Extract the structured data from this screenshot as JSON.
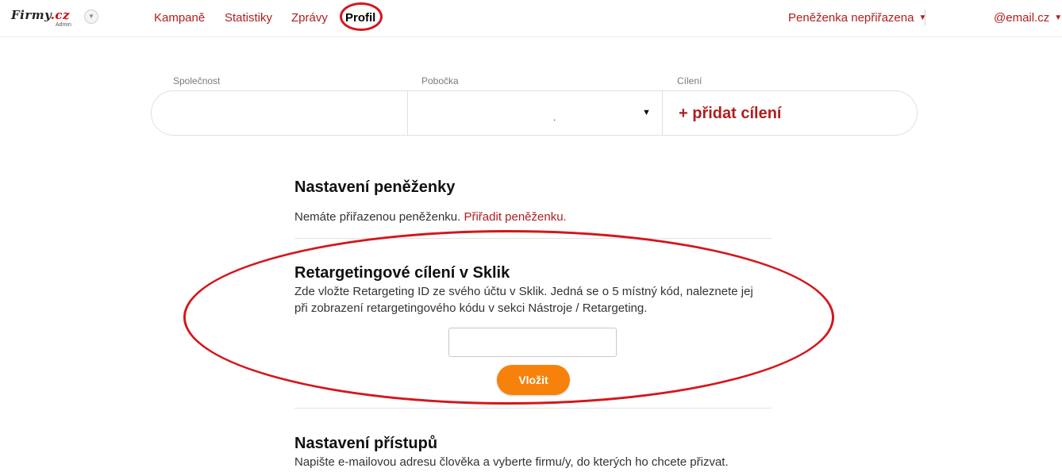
{
  "logo": {
    "brand": "Firmy",
    "domain": ".cz",
    "sub": "Admin"
  },
  "nav": [
    {
      "label": "Kampaně"
    },
    {
      "label": "Statistiky"
    },
    {
      "label": "Zprávy"
    },
    {
      "label": "Profil",
      "active": true
    }
  ],
  "header": {
    "wallet_status": "Peněženka nepřiřazena",
    "account": "@email.cz",
    "caret": "▼"
  },
  "filters": {
    "company_label": "Společnost",
    "company_value": "",
    "branch_label": "Pobočka",
    "branch_value": ".",
    "targeting_label": "Cílení",
    "add_targeting": "+ přidat cílení"
  },
  "wallet_section": {
    "title": "Nastavení peněženky",
    "text": "Nemáte přiřazenou peněženku.",
    "link": "Přiřadit peněženku."
  },
  "retargeting_section": {
    "title": "Retargetingové cílení v Sklik",
    "text_line1": "Zde vložte Retargeting ID ze svého účtu v Sklik. Jedná se o 5 místný kód, naleznete jej",
    "text_line2": "při zobrazení retargetingového kódu v sekci Nástroje / Retargeting.",
    "input_value": "",
    "submit_label": "Vložit"
  },
  "access_section": {
    "title": "Nastavení přístupů",
    "text": "Napište e-mailovou adresu člověka a vyberte firmu/y, do kterých ho chcete přizvat."
  },
  "colors": {
    "accent": "#b01e1e",
    "button": "#f7820b",
    "annotation": "#d4161c"
  }
}
